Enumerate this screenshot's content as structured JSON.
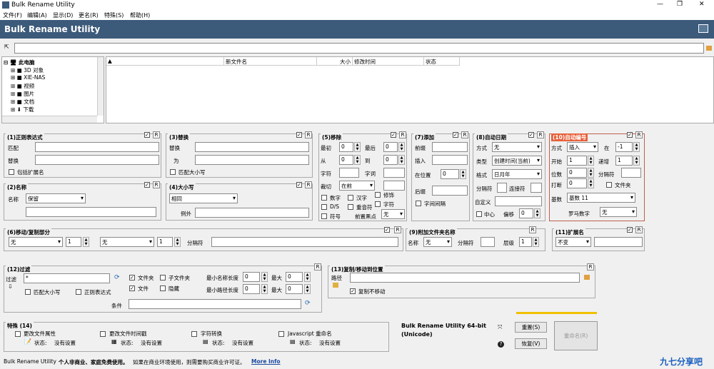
{
  "window": {
    "title": "Bulk Rename Utility",
    "app_header": "Bulk Rename Utility",
    "min": "—",
    "max": "❐",
    "close": "✕"
  },
  "menu": [
    "文件(F)",
    "编辑(A)",
    "显示(D)",
    "更名(R)",
    "特殊(S)",
    "帮助(H)"
  ],
  "tree": {
    "root": "此电脑",
    "items": [
      "3D 对象",
      "XIE-NAS",
      "视频",
      "图片",
      "文档",
      "下载"
    ]
  },
  "file_columns": [
    "新文件名",
    "大小",
    "修改时间",
    "状态"
  ],
  "p1": {
    "title": "(1)正则表达式",
    "match": "匹配",
    "replace": "替换",
    "include_ext": "包括扩展名"
  },
  "p2": {
    "title": "(2)名称",
    "name_label": "名称",
    "name_value": "保留"
  },
  "p3": {
    "title": "(3)替换",
    "replace": "替换",
    "with": "为",
    "match_case": "匹配大小写"
  },
  "p4": {
    "title": "(4)大小写",
    "case_value": "相同",
    "except": "例外"
  },
  "p5": {
    "title": "(5)移除",
    "first": "最初",
    "last": "最后",
    "from": "从",
    "to": "到",
    "chars": "字符",
    "words": "字词",
    "crop": "裁切",
    "crop_value": "在前",
    "digits": "数字",
    "ds": "D/S",
    "symbols": "符号",
    "chinese": "汉字",
    "dup": "重音符",
    "lead_dots": "前置黑点",
    "trim": "修饰",
    "chars2": "字符",
    "none": "无",
    "v0": "0"
  },
  "p7": {
    "title": "(7)添加",
    "prefix": "前缀",
    "insert": "插入",
    "at_pos": "在位置",
    "suffix": "后缀",
    "word_space": "字间间隔",
    "v0": "0"
  },
  "p8": {
    "title": "(8)自动日期",
    "mode": "方式",
    "mode_value": "无",
    "type": "类型",
    "type_value": "创建时间(当前)",
    "format": "格式",
    "format_value": "日月年",
    "sep": "分隔符",
    "connect": "连接符",
    "custom": "自定义",
    "center": "中心",
    "offset": "偏移",
    "v0": "0"
  },
  "p10": {
    "title": "(10)自动编号",
    "mode": "方式",
    "mode_value": "插入",
    "at": "在",
    "at_value": "-1",
    "start": "开始",
    "start_value": "1",
    "inc": "递增",
    "inc_value": "1",
    "pad": "位数",
    "pad_value": "0",
    "sep": "分隔符",
    "brk": "打断",
    "brk_value": "0",
    "folder": "文件夹",
    "base": "基数",
    "base_value": "基数 11",
    "roman": "罗马数字",
    "roman_value": "无"
  },
  "p6": {
    "title": "(6)移动/复制部分",
    "v1": "无",
    "v2": "1",
    "v3": "无",
    "v4": "1",
    "sep": "分隔符"
  },
  "p9": {
    "title": "(9)附加文件夹名称",
    "name": "名称",
    "name_value": "无",
    "sep": "分隔符",
    "level": "层级",
    "level_value": "1"
  },
  "p11": {
    "title": "(11)扩展名",
    "value": "不变"
  },
  "p12": {
    "title": "(12)过滤",
    "filter": "过滤",
    "filter_value": "*",
    "folders": "文件夹",
    "subfolders": "子文件夹",
    "files": "文件",
    "hidden": "隐藏",
    "min_name": "最小名称长度",
    "max": "最大",
    "min_path": "最小路径长度",
    "max2": "最大",
    "v0": "0",
    "match_case": "匹配大小写",
    "regex": "正则表达式",
    "cond": "条件"
  },
  "p13": {
    "title": "(13)复制/移动到位置",
    "path": "路径",
    "no_move": "复制不移动"
  },
  "p14": {
    "title": "特殊 (14)",
    "attrs": "更改文件属性",
    "ts": "更改文件时间戳",
    "trans": "字符转换",
    "js": "Javascript 重命名",
    "status": "状态:",
    "not_set": "没有设置"
  },
  "info": {
    "line1": "Bulk Rename Utility 64-bit",
    "line2": "(Unicode)"
  },
  "buttons": {
    "reset": "重置(S)",
    "undo": "恢复(V)",
    "rename": "重命名(R)",
    "R": "R"
  },
  "status": {
    "prefix": "Bulk Rename Utility",
    "bold": "个人非商业、家庭免费使用。",
    "text": "如果在商业环境使用，则需要购买商业许可证。",
    "link": "More Info"
  },
  "watermark": "九七分享吧"
}
